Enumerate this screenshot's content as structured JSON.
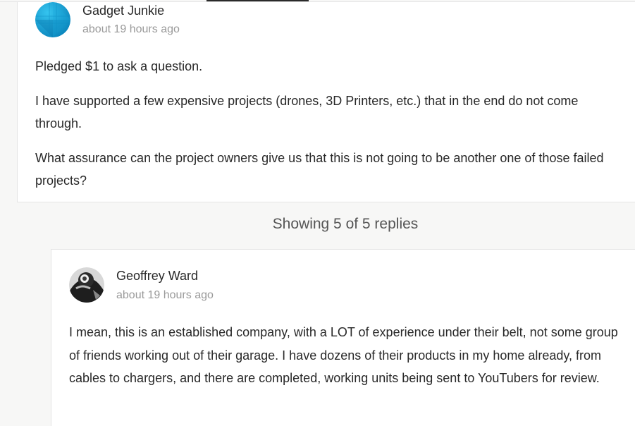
{
  "comment": {
    "author": "Gadget Junkie",
    "timestamp": "about 19 hours ago",
    "paragraphs": [
      "Pledged $1 to ask a question.",
      "I have supported a few expensive projects (drones, 3D Printers, etc.) that in the end do not come through.",
      "What assurance can the project owners give us that this is not going to be another one of those failed projects?"
    ],
    "avatar_color": "#0fa0d6"
  },
  "replies_summary": "Showing 5 of 5 replies",
  "reply": {
    "author": "Geoffrey Ward",
    "timestamp": "about 19 hours ago",
    "paragraphs": [
      "I mean, this is an established company, with a LOT of experience under their belt, not some group of friends working out of their garage. I have dozens of their products in my home already, from cables to chargers, and there are completed, working units being sent to YouTubers for review."
    ]
  }
}
